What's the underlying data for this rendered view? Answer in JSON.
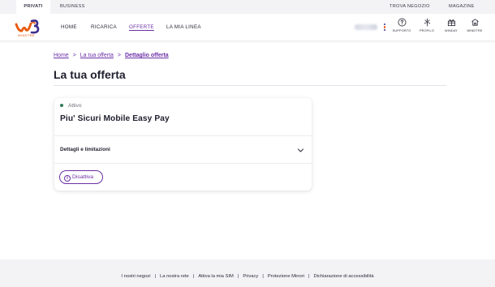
{
  "topbar": {
    "privati": "Privati",
    "business": "Business",
    "store": "Trova negozio",
    "magazine": "Magazine"
  },
  "header": {
    "logo_text": "WINDTRE",
    "nav": [
      {
        "label": "Home"
      },
      {
        "label": "Ricarica"
      },
      {
        "label": "Offerte",
        "active": true
      },
      {
        "label": "La mia linea"
      }
    ],
    "icons": [
      {
        "label": "Supporto",
        "icon": "help-circle-icon"
      },
      {
        "label": "Profilo",
        "icon": "profile-icon"
      },
      {
        "label": "WinDay",
        "icon": "gift-icon"
      },
      {
        "label": "WindTre",
        "icon": "windtre-icon"
      }
    ]
  },
  "breadcrumb": {
    "home": "Home",
    "parent": "La tua offerta",
    "current": "Dettaglio offerta",
    "sep": ">"
  },
  "page_title": "La tua offerta",
  "offer": {
    "status": "Attivo",
    "name": "Piu' Sicuri Mobile Easy Pay",
    "details_label": "Dettagli e limitazioni",
    "deactivate_label": "Disattiva",
    "info_glyph": "i"
  },
  "footer": {
    "links": [
      "I nostri negozi",
      "La nostra rete",
      "Attiva la mia SIM",
      "Privacy",
      "Protezione Minori",
      "Dichiarazione di accessibilità"
    ],
    "sep": "|"
  },
  "colors": {
    "accent": "#6b2fa6",
    "brand_orange": "#e8590c",
    "brand_navy": "#3d2f8e",
    "status_active": "#2e7d5a"
  }
}
